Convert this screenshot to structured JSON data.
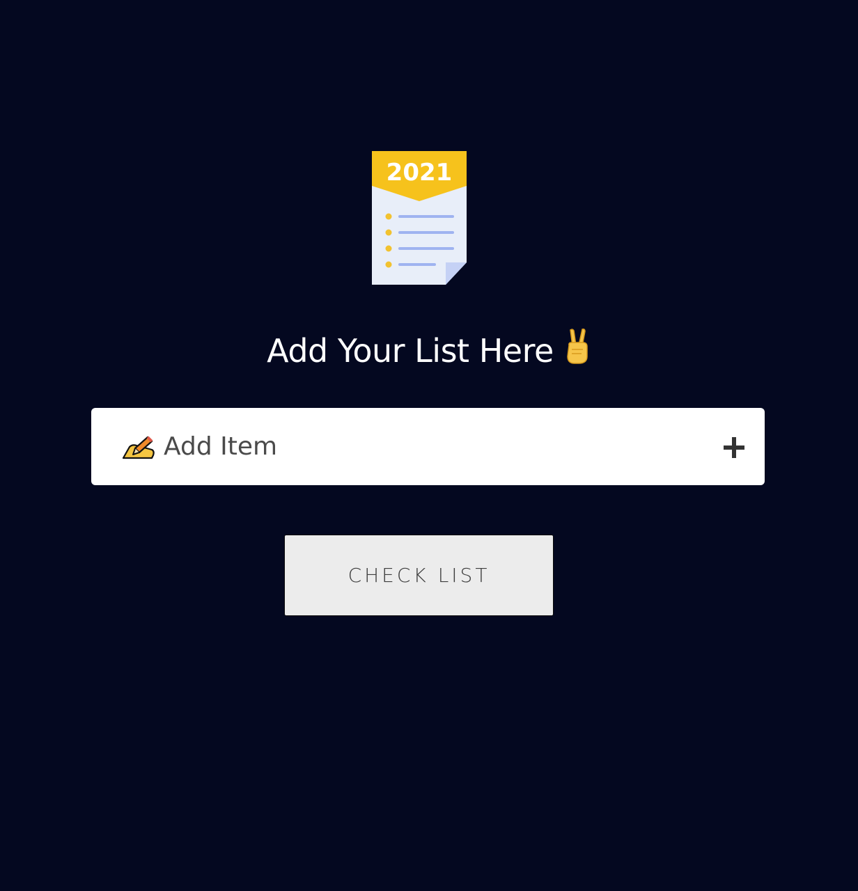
{
  "logo": {
    "year": "2021",
    "icon": "checklist-document-icon",
    "colors": {
      "banner": "#f5c518",
      "paper": "#e9eff9",
      "lines": "#9fb3f0",
      "bullets": "#f2c230"
    }
  },
  "heading": {
    "text": "Add Your List Here",
    "emoji_icon": "victory-hand-icon"
  },
  "input": {
    "placeholder": "Add Item",
    "value": "",
    "leading_icon": "writing-hand-icon",
    "trailing_icon": "plus-icon"
  },
  "button": {
    "label": "CHECK LIST"
  },
  "colors": {
    "background": "#040820",
    "input_bg": "#ffffff",
    "button_bg": "#ececec"
  }
}
